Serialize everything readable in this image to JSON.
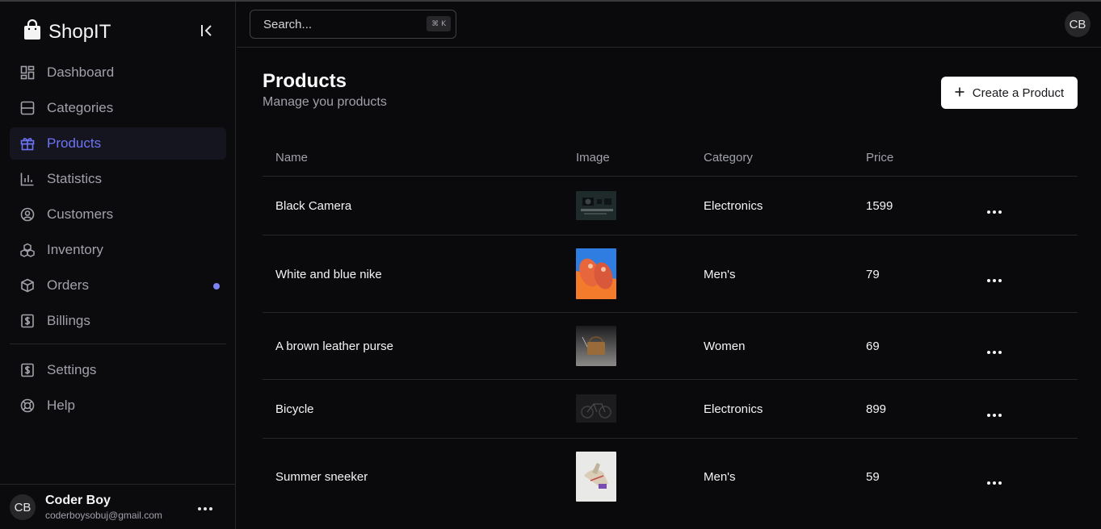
{
  "brand": {
    "name": "ShopIT"
  },
  "sidebar": {
    "items": [
      {
        "label": "Dashboard",
        "icon": "dashboard-icon"
      },
      {
        "label": "Categories",
        "icon": "categories-icon"
      },
      {
        "label": "Products",
        "icon": "gift-icon",
        "active": true
      },
      {
        "label": "Statistics",
        "icon": "bar-chart-icon"
      },
      {
        "label": "Customers",
        "icon": "user-circle-icon"
      },
      {
        "label": "Inventory",
        "icon": "boxes-icon"
      },
      {
        "label": "Orders",
        "icon": "package-icon",
        "badge_dot": true
      },
      {
        "label": "Billings",
        "icon": "dollar-receipt-icon"
      }
    ],
    "secondary": [
      {
        "label": "Settings",
        "icon": "dollar-receipt-icon"
      },
      {
        "label": "Help",
        "icon": "life-buoy-icon"
      }
    ],
    "user": {
      "initials": "CB",
      "name": "Coder Boy",
      "email": "coderboysobuj@gmail.com"
    }
  },
  "header": {
    "search_placeholder": "Search...",
    "shortcut": "⌘ K",
    "avatar_initials": "CB"
  },
  "main": {
    "title": "Products",
    "subtitle": "Manage you products",
    "create_label": "Create a Product",
    "columns": {
      "name": "Name",
      "image": "Image",
      "category": "Category",
      "price": "Price"
    },
    "rows": [
      {
        "name": "Black Camera",
        "image": "camera-photo",
        "category": "Electronics",
        "price": "1599"
      },
      {
        "name": "White and blue nike",
        "image": "sneakers-photo",
        "category": "Men's",
        "price": "79"
      },
      {
        "name": "A brown leather purse",
        "image": "purse-photo",
        "category": "Women",
        "price": "69"
      },
      {
        "name": "Bicycle",
        "image": "bicycle-photo",
        "category": "Electronics",
        "price": "899"
      },
      {
        "name": "Summer sneeker",
        "image": "sneaker-photo",
        "category": "Men's",
        "price": "59"
      }
    ]
  },
  "colors": {
    "accent": "#6d74f5",
    "background": "#0a0a0c",
    "border": "#27272a",
    "muted_text": "#a1a1aa"
  }
}
